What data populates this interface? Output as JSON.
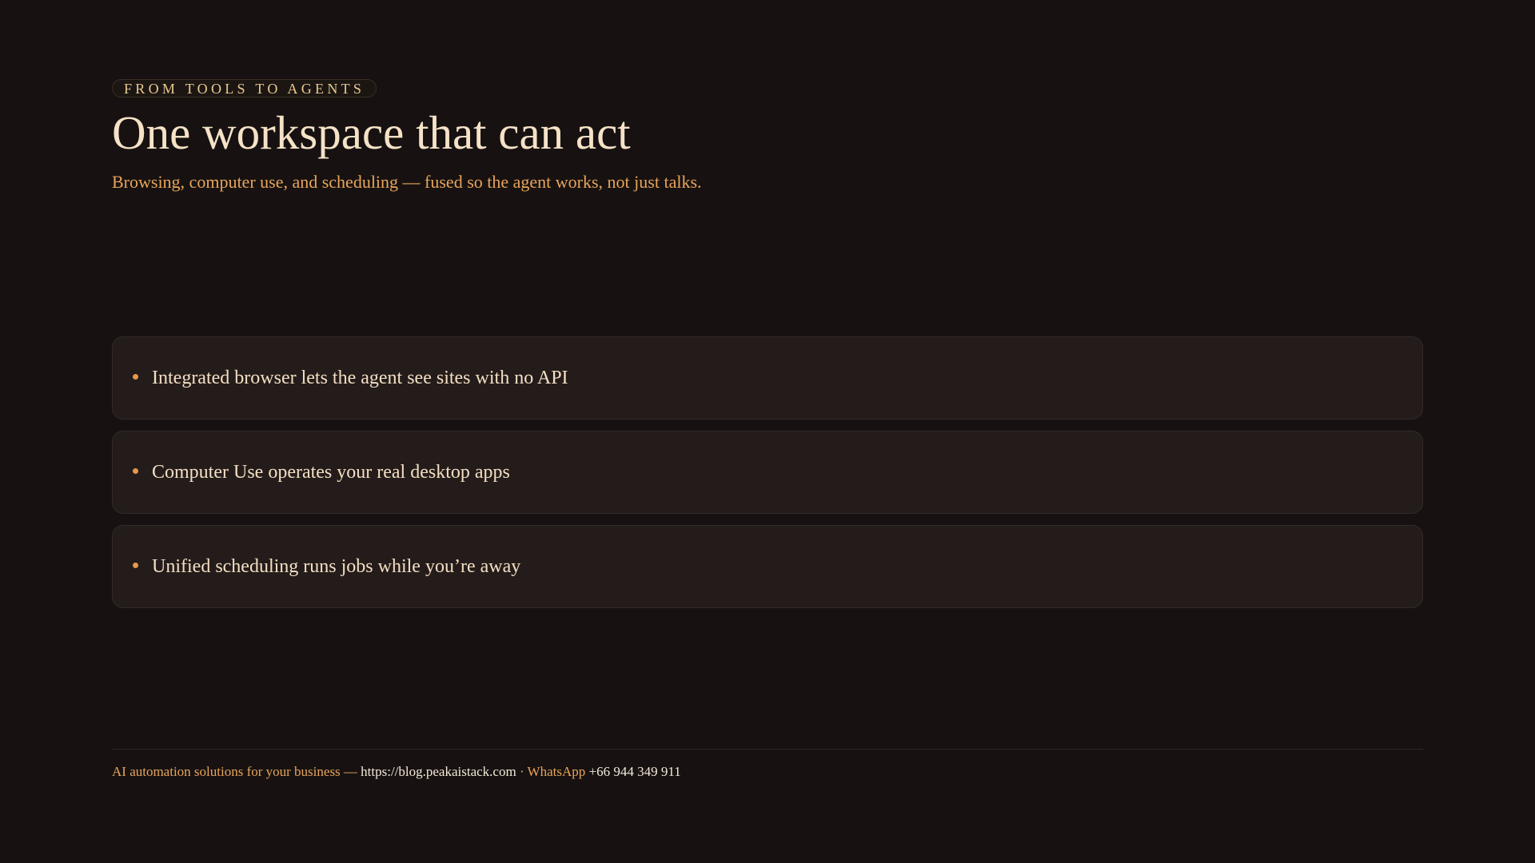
{
  "eyebrow": "FROM TOOLS TO AGENTS",
  "title": "One workspace that can act",
  "subtitle": "Browsing, computer use, and scheduling — fused so the agent works, not just talks.",
  "items": [
    {
      "text": "Integrated browser lets the agent see sites with no API"
    },
    {
      "text": "Computer Use operates your real desktop apps"
    },
    {
      "text": "Unified scheduling runs jobs while you’re away"
    }
  ],
  "footer": {
    "tagline": "AI automation solutions for your business — ",
    "url": "https://blog.peakaistack.com",
    "separator": " · ",
    "whatsapp_label": "WhatsApp ",
    "phone": "+66 944 349 911"
  },
  "colors": {
    "background": "#171211",
    "accent": "#e8a45b",
    "eyebrow_text": "#e8c98f",
    "title_text": "#f5e2c7",
    "card_background": "#241c1a",
    "bullet": "#e6984d"
  }
}
